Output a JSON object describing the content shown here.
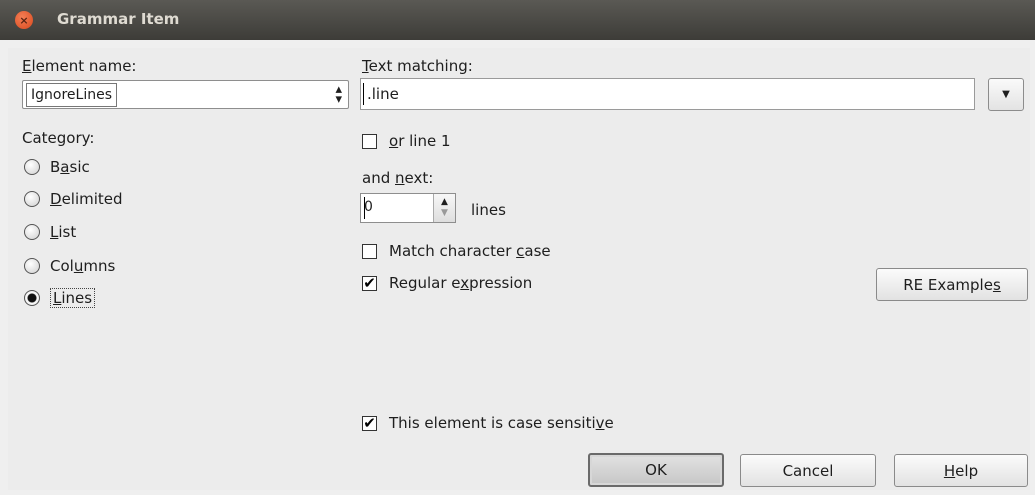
{
  "window": {
    "title": "Grammar Item",
    "close_glyph": "×"
  },
  "element_name": {
    "label_first": "E",
    "label_rest": "lement name:",
    "value": "IgnoreLines"
  },
  "text_matching": {
    "label_first": "T",
    "label_rest": "ext matching:",
    "value": ".line"
  },
  "category": {
    "label": "Category:",
    "options": [
      {
        "pre": "B",
        "key": "a",
        "post": "sic",
        "checked": false
      },
      {
        "pre": "",
        "key": "D",
        "post": "elimited",
        "checked": false
      },
      {
        "pre": "",
        "key": "L",
        "post": "ist",
        "checked": false
      },
      {
        "pre": "Col",
        "key": "u",
        "post": "mns",
        "checked": false
      },
      {
        "pre": "",
        "key": "L",
        "post": "ines",
        "checked": true
      }
    ]
  },
  "or_line_1": {
    "key": "o",
    "post": "r line 1",
    "checked": false
  },
  "and_next": {
    "label_pre": "and ",
    "label_key": "n",
    "label_post": "ext:",
    "value": "0",
    "unit": "lines"
  },
  "match_case": {
    "pre": "Match character ",
    "key": "c",
    "post": "ase",
    "checked": false
  },
  "regex": {
    "pre": "Regular e",
    "key": "x",
    "post": "pression",
    "checked": true
  },
  "re_examples": {
    "pre": "RE Example",
    "key": "s",
    "post": ""
  },
  "case_sensitive": {
    "pre": "This element is case sensiti",
    "key": "v",
    "post": "e",
    "checked": true
  },
  "buttons": {
    "ok": "OK",
    "cancel": "Cancel",
    "help_key": "H",
    "help_post": "elp"
  },
  "check_glyph": "✔"
}
